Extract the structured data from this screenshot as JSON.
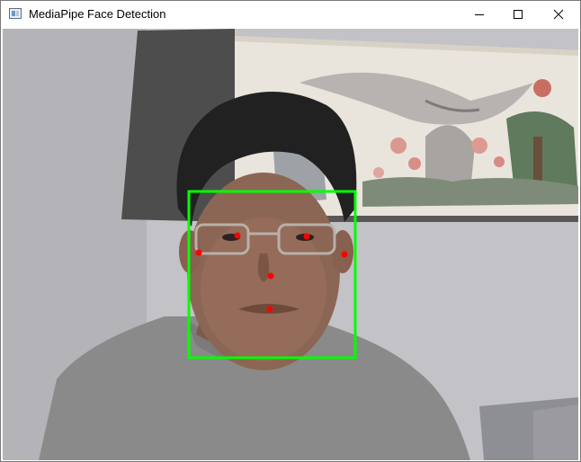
{
  "window": {
    "title": "MediaPipe Face Detection",
    "icon": "app-window-icon",
    "controls": [
      "minimize-icon",
      "maximize-icon",
      "close-icon"
    ]
  },
  "detection": {
    "box_color": "#00ff00",
    "keypoint_color": "#ff0000"
  }
}
